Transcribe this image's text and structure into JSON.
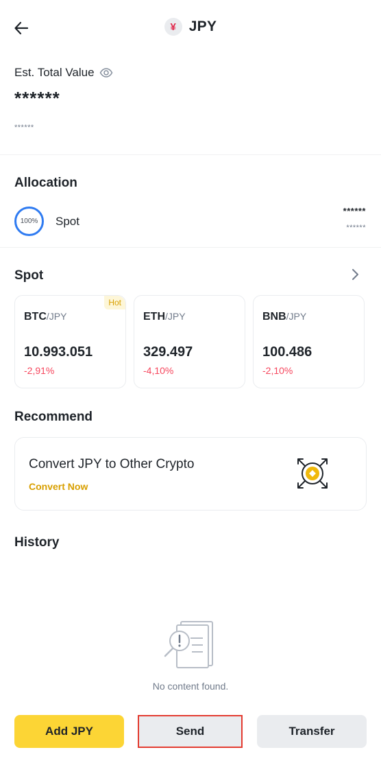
{
  "header": {
    "title": "JPY",
    "coin_symbol": "¥",
    "back_icon": "arrow-left-icon"
  },
  "balance": {
    "label": "Est. Total Value",
    "value": "******",
    "sub_value": "******",
    "toggle_icon": "eye-icon"
  },
  "allocation": {
    "title": "Allocation",
    "items": [
      {
        "percent": "100%",
        "name": "Spot",
        "value": "******",
        "sub_value": "******"
      }
    ]
  },
  "spot": {
    "title": "Spot",
    "pairs": [
      {
        "base": "BTC",
        "quote": "/JPY",
        "price": "10.993.051",
        "change": "-2,91%",
        "badge": "Hot"
      },
      {
        "base": "ETH",
        "quote": "/JPY",
        "price": "329.497",
        "change": "-4,10%"
      },
      {
        "base": "BNB",
        "quote": "/JPY",
        "price": "100.486",
        "change": "-2,10%"
      }
    ]
  },
  "recommend": {
    "title": "Recommend",
    "card_title": "Convert JPY to Other Crypto",
    "card_link": "Convert Now"
  },
  "history": {
    "title": "History",
    "empty_text": "No content found."
  },
  "actions": {
    "add": "Add JPY",
    "send": "Send",
    "transfer": "Transfer"
  },
  "colors": {
    "accent": "#fcd535",
    "negative": "#f6465d",
    "link": "#d89f00",
    "ring": "#2f7bf1",
    "highlight": "#e33a2f"
  }
}
